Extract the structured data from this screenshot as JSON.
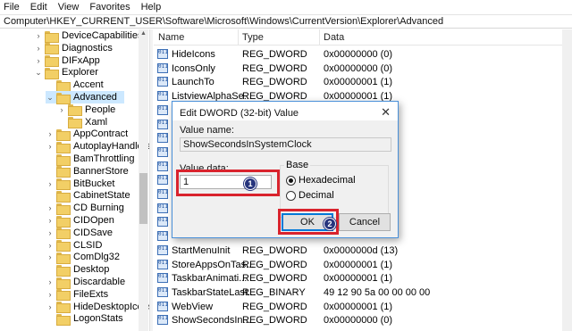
{
  "menu": [
    "File",
    "Edit",
    "View",
    "Favorites",
    "Help"
  ],
  "address": "Computer\\HKEY_CURRENT_USER\\Software\\Microsoft\\Windows\\CurrentVersion\\Explorer\\Advanced",
  "tree": [
    {
      "label": "DeviceCapabilities",
      "chevron": ">",
      "selected": false
    },
    {
      "label": "Diagnostics",
      "chevron": ">",
      "selected": false
    },
    {
      "label": "DIFxApp",
      "chevron": ">",
      "selected": false
    },
    {
      "label": "Explorer",
      "chevron": "v",
      "selected": false
    },
    {
      "label": "Accent",
      "chevron": "",
      "selected": false
    },
    {
      "label": "Advanced",
      "chevron": "v",
      "selected": true
    },
    {
      "label": "People",
      "chevron": ">",
      "selected": false
    },
    {
      "label": "Xaml",
      "chevron": "",
      "selected": false
    },
    {
      "label": "AppContract",
      "chevron": ">",
      "selected": false
    },
    {
      "label": "AutoplayHandlers",
      "chevron": ">",
      "selected": false
    },
    {
      "label": "BamThrottling",
      "chevron": "",
      "selected": false
    },
    {
      "label": "BannerStore",
      "chevron": "",
      "selected": false
    },
    {
      "label": "BitBucket",
      "chevron": ">",
      "selected": false
    },
    {
      "label": "CabinetState",
      "chevron": "",
      "selected": false
    },
    {
      "label": "CD Burning",
      "chevron": ">",
      "selected": false
    },
    {
      "label": "CIDOpen",
      "chevron": ">",
      "selected": false
    },
    {
      "label": "CIDSave",
      "chevron": ">",
      "selected": false
    },
    {
      "label": "CLSID",
      "chevron": ">",
      "selected": false
    },
    {
      "label": "ComDlg32",
      "chevron": ">",
      "selected": false
    },
    {
      "label": "Desktop",
      "chevron": "",
      "selected": false
    },
    {
      "label": "Discardable",
      "chevron": ">",
      "selected": false
    },
    {
      "label": "FileExts",
      "chevron": ">",
      "selected": false
    },
    {
      "label": "HideDesktopIcons",
      "chevron": ">",
      "selected": false
    },
    {
      "label": "LogonStats",
      "chevron": "",
      "selected": false
    }
  ],
  "columns": {
    "name": "Name",
    "type": "Type",
    "data": "Data"
  },
  "rows": [
    {
      "name": "HideIcons",
      "type": "REG_DWORD",
      "data": "0x00000000 (0)",
      "icon": "dword"
    },
    {
      "name": "IconsOnly",
      "type": "REG_DWORD",
      "data": "0x00000000 (0)",
      "icon": "dword"
    },
    {
      "name": "LaunchTo",
      "type": "REG_DWORD",
      "data": "0x00000001 (1)",
      "icon": "dword"
    },
    {
      "name": "ListviewAlphaSe...",
      "type": "REG_DWORD",
      "data": "0x00000001 (1)",
      "icon": "dword"
    },
    {
      "name": "",
      "type": "",
      "data": "",
      "icon": "dword"
    },
    {
      "name": "",
      "type": "",
      "data": "",
      "icon": "dword"
    },
    {
      "name": "",
      "type": "",
      "data": "",
      "icon": "dword"
    },
    {
      "name": "",
      "type": "",
      "data": "",
      "icon": "dword"
    },
    {
      "name": "",
      "type": "",
      "data": "",
      "icon": "dword"
    },
    {
      "name": "",
      "type": "",
      "data": "",
      "icon": "dword"
    },
    {
      "name": "",
      "type": "",
      "data": "",
      "icon": "dword"
    },
    {
      "name": "",
      "type": "",
      "data": "",
      "icon": "dword"
    },
    {
      "name": "",
      "type": "",
      "data": "",
      "icon": "dword"
    },
    {
      "name": "",
      "type": "",
      "data": "",
      "icon": "dword"
    },
    {
      "name": "StartMenuInit",
      "type": "REG_DWORD",
      "data": "0x0000000d (13)",
      "icon": "dword"
    },
    {
      "name": "StoreAppsOnTas...",
      "type": "REG_DWORD",
      "data": "0x00000001 (1)",
      "icon": "dword"
    },
    {
      "name": "TaskbarAnimati...",
      "type": "REG_DWORD",
      "data": "0x00000001 (1)",
      "icon": "dword"
    },
    {
      "name": "TaskbarStateLast...",
      "type": "REG_BINARY",
      "data": "49 12 90 5a 00 00 00 00",
      "icon": "binary"
    },
    {
      "name": "WebView",
      "type": "REG_DWORD",
      "data": "0x00000001 (1)",
      "icon": "dword"
    },
    {
      "name": "ShowSecondsIn...",
      "type": "REG_DWORD",
      "data": "0x00000000 (0)",
      "icon": "dword"
    }
  ],
  "dialog": {
    "title": "Edit DWORD (32-bit) Value",
    "close_glyph": "✕",
    "value_name_label": "Value name:",
    "value_name": "ShowSecondsInSystemClock",
    "value_data_label": "Value data:",
    "value_data": "1",
    "base_label": "Base",
    "hex_label": "Hexadecimal",
    "dec_label": "Decimal",
    "base_selected": "Hexadecimal",
    "ok_label": "OK",
    "cancel_label": "Cancel"
  },
  "annotations": [
    {
      "number": "1",
      "color": "#27357e"
    },
    {
      "number": "2",
      "color": "#27357e"
    }
  ],
  "highlight_color": "#d9232d"
}
